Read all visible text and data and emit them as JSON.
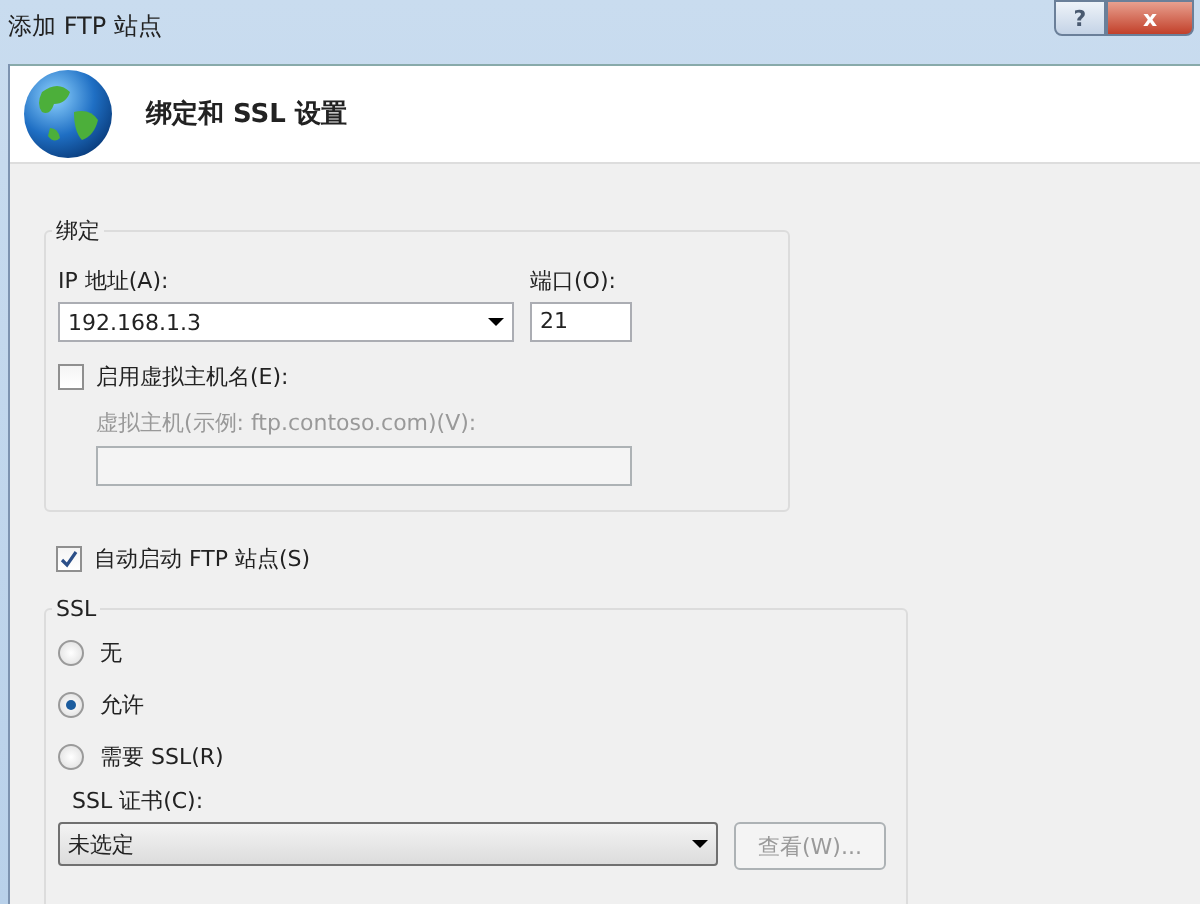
{
  "window": {
    "title": "添加 FTP 站点",
    "help_button": "?",
    "close_button": "x"
  },
  "header": {
    "title": "绑定和 SSL 设置"
  },
  "binding": {
    "legend": "绑定",
    "ip_label": "IP 地址(A):",
    "ip_value": "192.168.1.3",
    "port_label": "端口(O):",
    "port_value": "21",
    "virtual_host": {
      "label": "启用虚拟主机名(E):",
      "checked": false
    },
    "host_label": "虚拟主机(示例: ftp.contoso.com)(V):",
    "host_disabled": true
  },
  "autostart": {
    "label": "自动启动 FTP 站点(S)",
    "checked": true
  },
  "ssl": {
    "legend": "SSL",
    "options": [
      {
        "label": "无",
        "selected": false
      },
      {
        "label": "允许",
        "selected": true
      },
      {
        "label": "需要 SSL(R)",
        "selected": false
      }
    ],
    "cert_label": "SSL 证书(C):",
    "cert_value": "未选定",
    "view_button": {
      "label": "查看(W)...",
      "disabled": true
    }
  }
}
